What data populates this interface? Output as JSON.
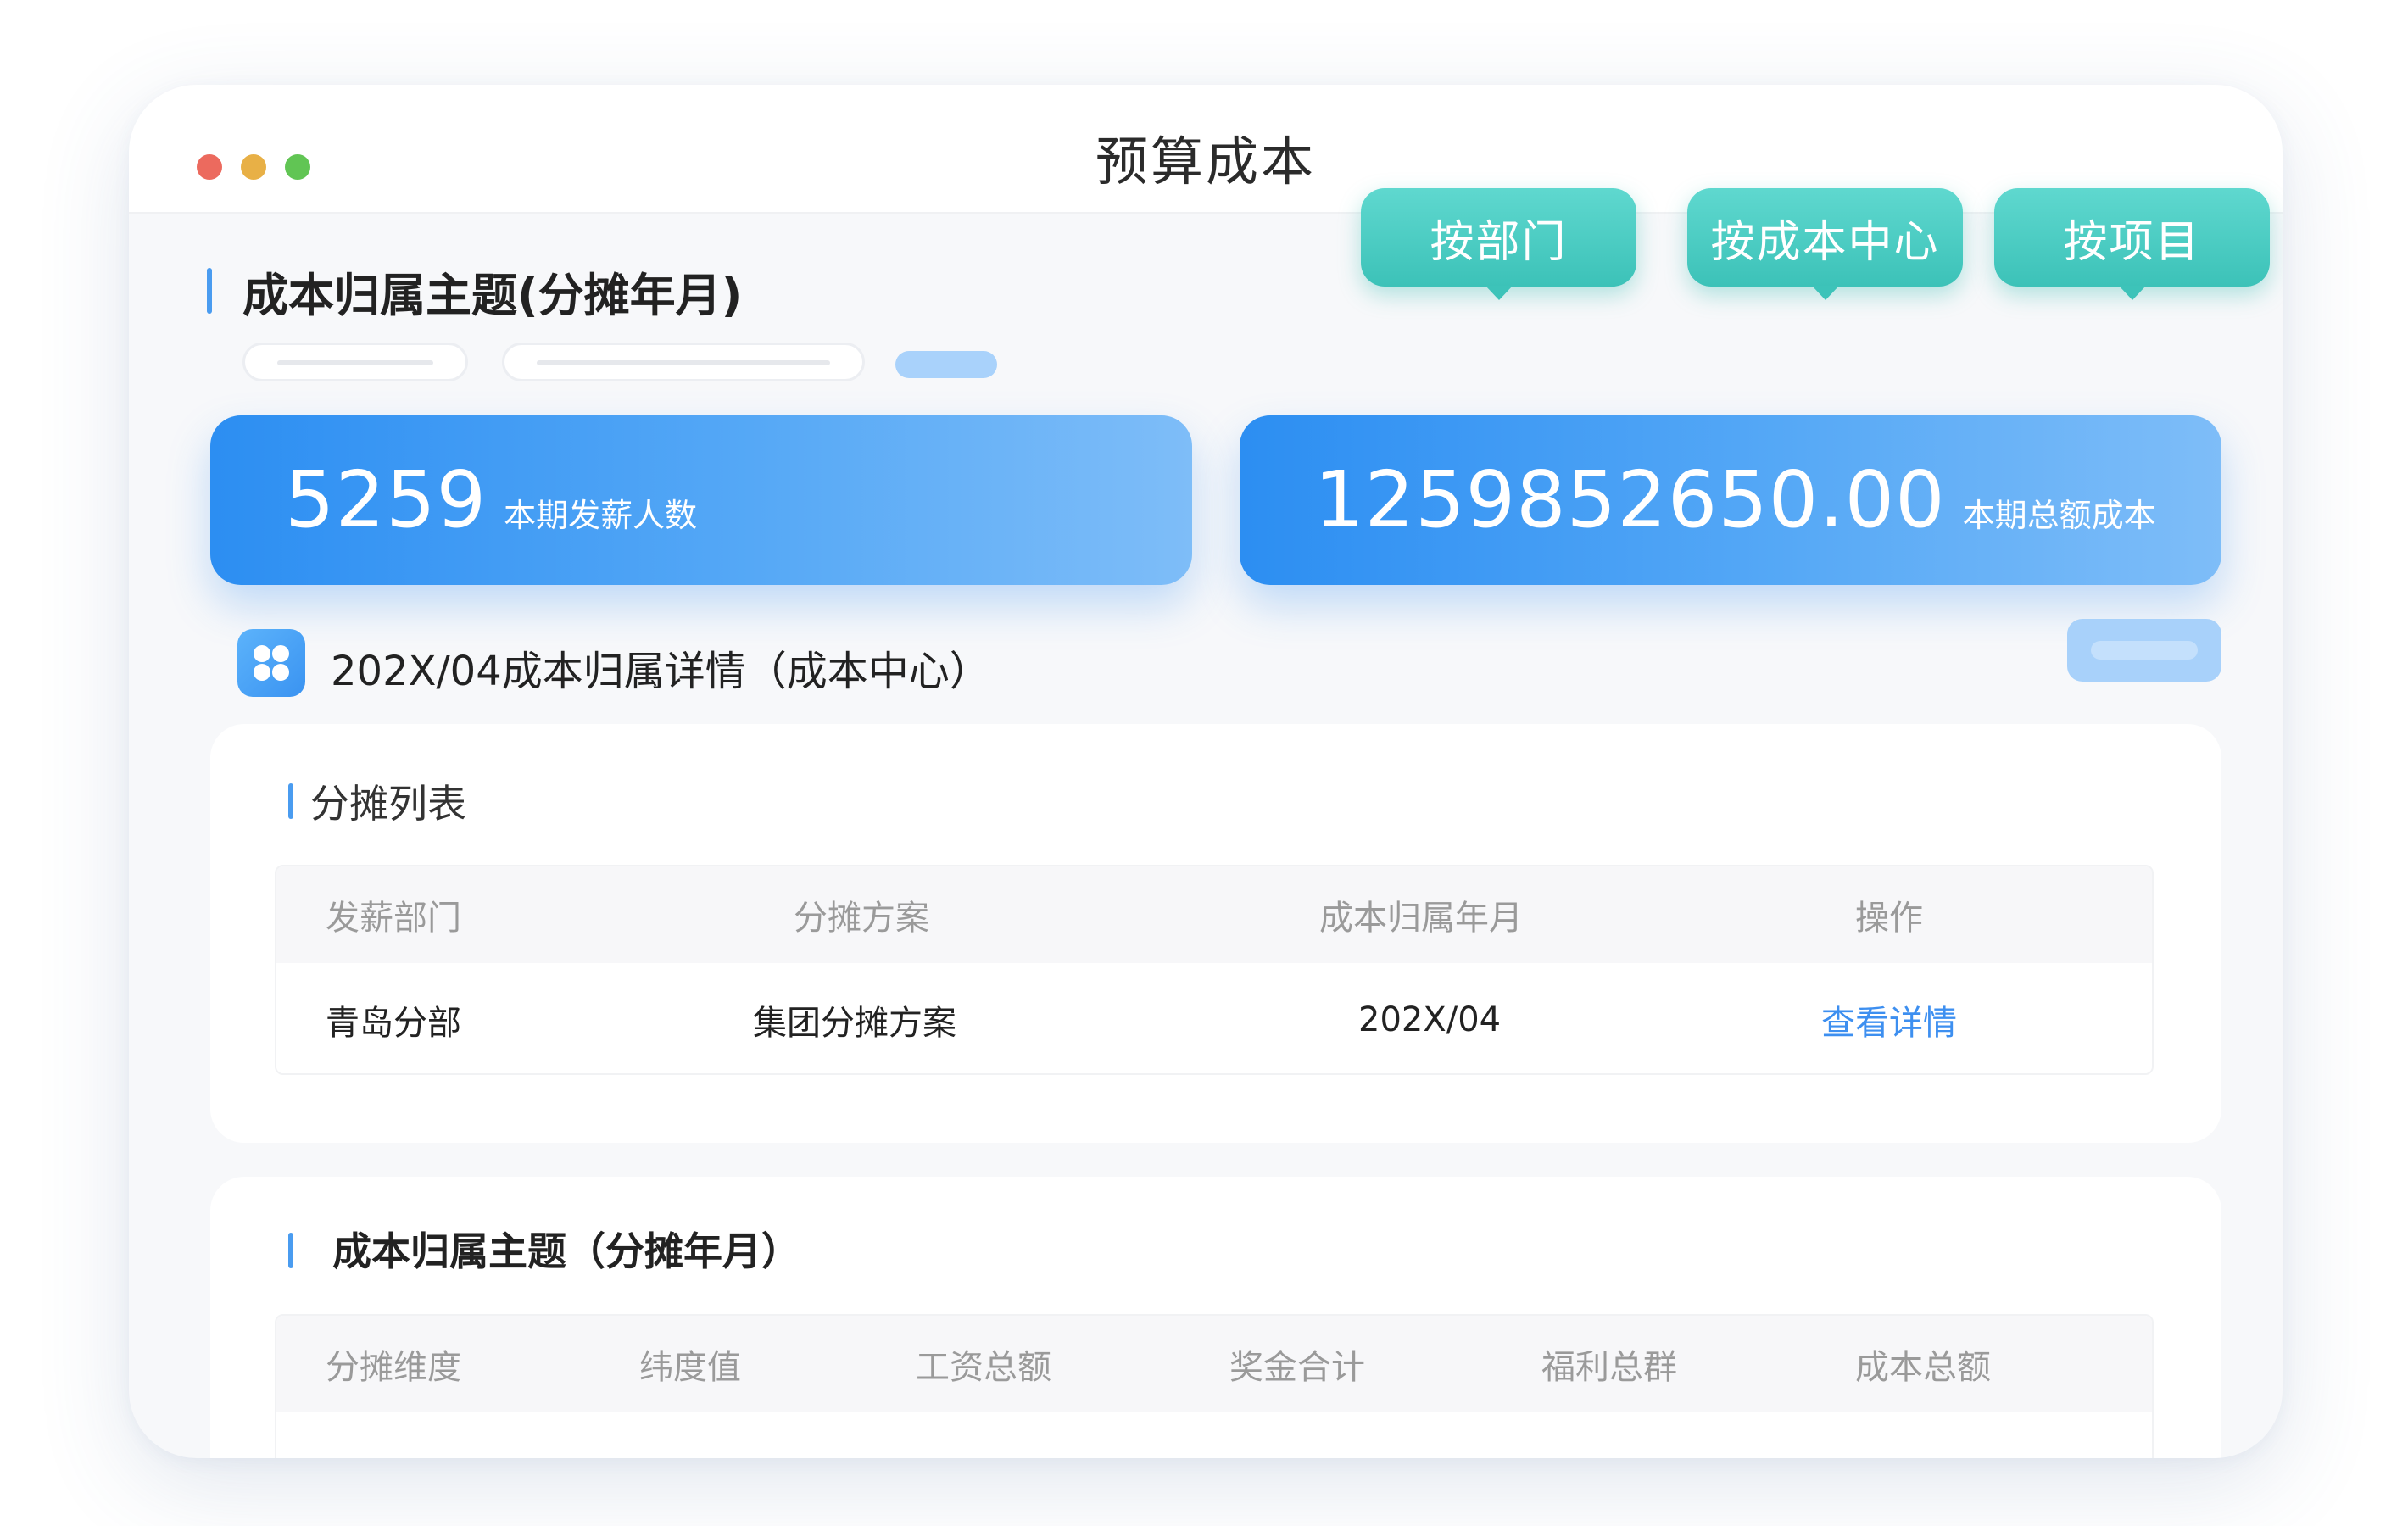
{
  "window": {
    "title": "预算成本"
  },
  "theme": {
    "title": "成本归属主题(分摊年月)"
  },
  "tabs": [
    {
      "label": "按部门"
    },
    {
      "label": "按成本中心"
    },
    {
      "label": "按项目"
    }
  ],
  "stats": [
    {
      "value": "5259",
      "label": "本期发薪人数"
    },
    {
      "value": "1259852650.00",
      "label": "本期总额成本"
    }
  ],
  "detail": {
    "title": "202X/04成本归属详情（成本中心）",
    "icon": "grid-four-dots-icon"
  },
  "allocation_list": {
    "title": "分摊列表",
    "columns": [
      "发薪部门",
      "分摊方案",
      "成本归属年月",
      "操作"
    ],
    "rows": [
      {
        "department": "青岛分部",
        "scheme": "集团分摊方案",
        "month": "202X/04",
        "action": "查看详情"
      }
    ]
  },
  "theme_table": {
    "title": "成本归属主题（分摊年月）",
    "columns": [
      "分摊维度",
      "纬度值",
      "工资总额",
      "奖金合计",
      "福利总群",
      "成本总额"
    ]
  },
  "colors": {
    "accent": "#4a9cf0",
    "teal": "#3cc2b8",
    "link": "#3d8ff0"
  }
}
